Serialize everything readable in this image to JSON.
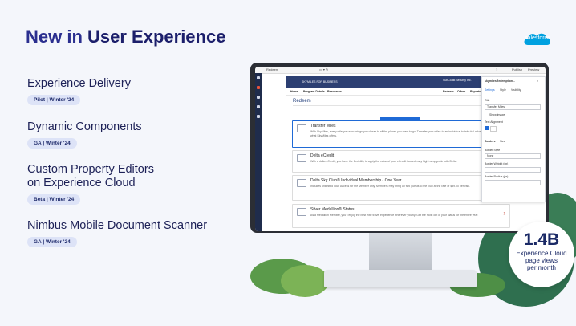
{
  "slide": {
    "title_prefix": "New in ",
    "title_highlight": "User Experience",
    "logo": "salesforce",
    "features": [
      {
        "name": "Experience Delivery",
        "badge": "Pilot | Winter '24"
      },
      {
        "name": "Dynamic Components",
        "badge": "GA | Winter '24"
      },
      {
        "name": "Custom Property Editors",
        "name2": "on Experience Cloud",
        "badge": "Beta | Winter '24"
      },
      {
        "name": "Nimbus Mobile Document Scanner",
        "badge": "GA | Winter '24"
      }
    ],
    "stat": {
      "value": "1.4B",
      "label1": "Experience Cloud",
      "label2": "page views",
      "label3": "per month"
    }
  },
  "screen": {
    "topbar_title": "Redeem",
    "topbar_right1": "Publish",
    "topbar_right2": "Preview",
    "hero_brand": "SKYMILES FOR BUSINESS",
    "hero_right": "SunCoast Security Inc.",
    "nav_items": [
      "Home",
      "Program Details",
      "Resources"
    ],
    "nav_right": [
      "Redeem",
      "Offers",
      "Reports"
    ],
    "page_heading": "Redeem",
    "cards": [
      {
        "title": "Transfer Miles",
        "desc": "With SkyMiles, every mile you earn brings you closer to all the places you want to go. Transfer your miles to an individual to take full advantage of what SkyMiles offers."
      },
      {
        "title": "Delta eCredit",
        "desc": "With a delta eCredit, you have the flexibility to apply the value of your eCredit towards any flight or upgrade with Delta."
      },
      {
        "title": "Delta Sky Club® Individual Membership - One Year",
        "desc": "Includes unlimited Club Access for the Member only. Members may bring up two guests to the club at the rate of $39.00 per visit."
      },
      {
        "title": "Silver Medallion® Status",
        "desc": "As a Medallion Member, you'll enjoy the best elite travel experience wherever you fly. Get the most out of your status for the entire year."
      }
    ],
    "panel": {
      "title": "skymilesRedemption...",
      "tabs": [
        "Settings",
        "Style",
        "Visibility"
      ],
      "title_label": "Title",
      "title_value": "Transfer Miles",
      "show_image": "Show image",
      "text_alignment": "Text Alignment",
      "tabs2": [
        "Borders",
        "Size"
      ],
      "border_style_label": "Border Style",
      "border_style_value": "None",
      "border_weight_label": "Border Weight (px)",
      "border_radius_label": "Border Radius (px)"
    }
  },
  "colors": {
    "title": "#2b2f8f",
    "brand_blue": "#00a1e0",
    "hero_navy": "#2c3f72"
  }
}
